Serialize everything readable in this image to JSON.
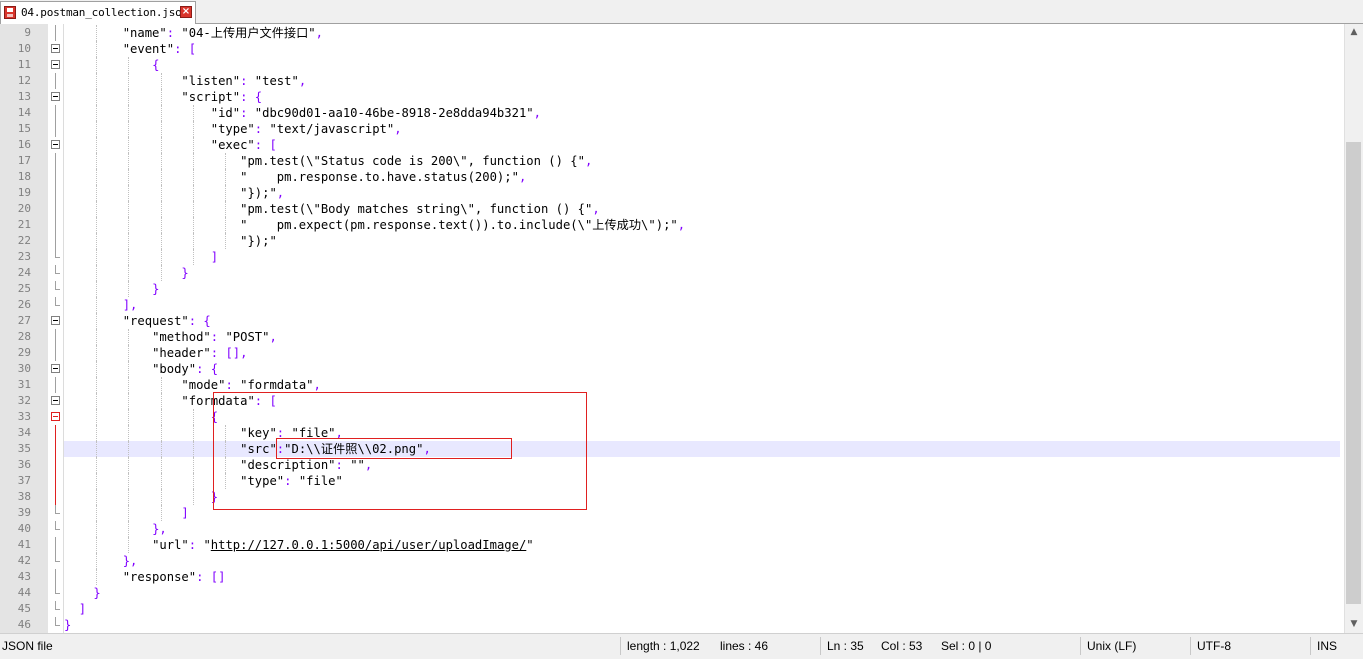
{
  "tab": {
    "filename": "04.postman_collection.json",
    "save_icon": "save-icon",
    "close_icon": "close-icon"
  },
  "editor": {
    "lines": [
      {
        "n": "9",
        "segs": [
          [
            "        ",
            ""
          ],
          [
            "\"name\"",
            "key"
          ],
          [
            ": ",
            "punc"
          ],
          [
            "\"04-上传用户文件接口\"",
            "str"
          ],
          [
            ",",
            "punc"
          ]
        ]
      },
      {
        "n": "10",
        "segs": [
          [
            "        ",
            ""
          ],
          [
            "\"event\"",
            "key"
          ],
          [
            ": [",
            "punc"
          ]
        ]
      },
      {
        "n": "11",
        "segs": [
          [
            "            ",
            ""
          ],
          [
            "{",
            "punc"
          ]
        ]
      },
      {
        "n": "12",
        "segs": [
          [
            "                ",
            ""
          ],
          [
            "\"listen\"",
            "key"
          ],
          [
            ": ",
            "punc"
          ],
          [
            "\"test\"",
            "str"
          ],
          [
            ",",
            "punc"
          ]
        ]
      },
      {
        "n": "13",
        "segs": [
          [
            "                ",
            ""
          ],
          [
            "\"script\"",
            "key"
          ],
          [
            ": {",
            "punc"
          ]
        ]
      },
      {
        "n": "14",
        "segs": [
          [
            "                    ",
            ""
          ],
          [
            "\"id\"",
            "key"
          ],
          [
            ": ",
            "punc"
          ],
          [
            "\"dbc90d01-aa10-46be-8918-2e8dda94b321\"",
            "str"
          ],
          [
            ",",
            "punc"
          ]
        ]
      },
      {
        "n": "15",
        "segs": [
          [
            "                    ",
            ""
          ],
          [
            "\"type\"",
            "key"
          ],
          [
            ": ",
            "punc"
          ],
          [
            "\"text/javascript\"",
            "str"
          ],
          [
            ",",
            "punc"
          ]
        ]
      },
      {
        "n": "16",
        "segs": [
          [
            "                    ",
            ""
          ],
          [
            "\"exec\"",
            "key"
          ],
          [
            ": [",
            "punc"
          ]
        ]
      },
      {
        "n": "17",
        "segs": [
          [
            "                        ",
            ""
          ],
          [
            "\"pm.test(\\\"Status code is 200\\\", function () {\"",
            "str"
          ],
          [
            ",",
            "punc"
          ]
        ]
      },
      {
        "n": "18",
        "segs": [
          [
            "                        ",
            ""
          ],
          [
            "\"    pm.response.to.have.status(200);\"",
            "str"
          ],
          [
            ",",
            "punc"
          ]
        ]
      },
      {
        "n": "19",
        "segs": [
          [
            "                        ",
            ""
          ],
          [
            "\"});\"",
            "str"
          ],
          [
            ",",
            "punc"
          ]
        ]
      },
      {
        "n": "20",
        "segs": [
          [
            "                        ",
            ""
          ],
          [
            "\"pm.test(\\\"Body matches string\\\", function () {\"",
            "str"
          ],
          [
            ",",
            "punc"
          ]
        ]
      },
      {
        "n": "21",
        "segs": [
          [
            "                        ",
            ""
          ],
          [
            "\"    pm.expect(pm.response.text()).to.include(\\\"上传成功\\\");\"",
            "str"
          ],
          [
            ",",
            "punc"
          ]
        ]
      },
      {
        "n": "22",
        "segs": [
          [
            "                        ",
            ""
          ],
          [
            "\"});\"",
            "str"
          ]
        ]
      },
      {
        "n": "23",
        "segs": [
          [
            "                    ",
            ""
          ],
          [
            "]",
            "punc"
          ]
        ]
      },
      {
        "n": "24",
        "segs": [
          [
            "                ",
            ""
          ],
          [
            "}",
            "punc"
          ]
        ]
      },
      {
        "n": "25",
        "segs": [
          [
            "            ",
            ""
          ],
          [
            "}",
            "punc"
          ]
        ]
      },
      {
        "n": "26",
        "segs": [
          [
            "        ",
            ""
          ],
          [
            "],",
            "punc"
          ]
        ]
      },
      {
        "n": "27",
        "segs": [
          [
            "        ",
            ""
          ],
          [
            "\"request\"",
            "key"
          ],
          [
            ": {",
            "punc"
          ]
        ]
      },
      {
        "n": "28",
        "segs": [
          [
            "            ",
            ""
          ],
          [
            "\"method\"",
            "key"
          ],
          [
            ": ",
            "punc"
          ],
          [
            "\"POST\"",
            "str"
          ],
          [
            ",",
            "punc"
          ]
        ]
      },
      {
        "n": "29",
        "segs": [
          [
            "            ",
            ""
          ],
          [
            "\"header\"",
            "key"
          ],
          [
            ": [],",
            "punc"
          ]
        ]
      },
      {
        "n": "30",
        "segs": [
          [
            "            ",
            ""
          ],
          [
            "\"body\"",
            "key"
          ],
          [
            ": {",
            "punc"
          ]
        ]
      },
      {
        "n": "31",
        "segs": [
          [
            "                ",
            ""
          ],
          [
            "\"mode\"",
            "key"
          ],
          [
            ": ",
            "punc"
          ],
          [
            "\"formdata\"",
            "str"
          ],
          [
            ",",
            "punc"
          ]
        ]
      },
      {
        "n": "32",
        "segs": [
          [
            "                ",
            ""
          ],
          [
            "\"formdata\"",
            "key"
          ],
          [
            ": [",
            "punc"
          ]
        ]
      },
      {
        "n": "33",
        "segs": [
          [
            "                    ",
            ""
          ],
          [
            "{",
            "punc"
          ]
        ]
      },
      {
        "n": "34",
        "segs": [
          [
            "                        ",
            ""
          ],
          [
            "\"key\"",
            "key"
          ],
          [
            ": ",
            "punc"
          ],
          [
            "\"file\"",
            "str"
          ],
          [
            ",",
            "punc"
          ]
        ]
      },
      {
        "n": "35",
        "segs": [
          [
            "                        ",
            ""
          ],
          [
            "\"src\"",
            "key"
          ],
          [
            ":",
            "punc"
          ],
          [
            "\"D:\\\\证件照\\\\02.png\"",
            "str"
          ],
          [
            ",",
            "punc"
          ]
        ]
      },
      {
        "n": "36",
        "segs": [
          [
            "                        ",
            ""
          ],
          [
            "\"description\"",
            "key"
          ],
          [
            ": ",
            "punc"
          ],
          [
            "\"\"",
            "str"
          ],
          [
            ",",
            "punc"
          ]
        ]
      },
      {
        "n": "37",
        "segs": [
          [
            "                        ",
            ""
          ],
          [
            "\"type\"",
            "key"
          ],
          [
            ": ",
            "punc"
          ],
          [
            "\"file\"",
            "str"
          ]
        ]
      },
      {
        "n": "38",
        "segs": [
          [
            "                    ",
            ""
          ],
          [
            "}",
            "punc"
          ]
        ]
      },
      {
        "n": "39",
        "segs": [
          [
            "                ",
            ""
          ],
          [
            "]",
            "punc"
          ]
        ]
      },
      {
        "n": "40",
        "segs": [
          [
            "            ",
            ""
          ],
          [
            "},",
            "punc"
          ]
        ]
      },
      {
        "n": "41",
        "segs": [
          [
            "            ",
            ""
          ],
          [
            "\"url\"",
            "key"
          ],
          [
            ": ",
            "punc"
          ],
          [
            "\"",
            "str"
          ],
          [
            "http://127.0.0.1:5000/api/user/uploadImage/",
            "url"
          ],
          [
            "\"",
            "str"
          ]
        ]
      },
      {
        "n": "42",
        "segs": [
          [
            "        ",
            ""
          ],
          [
            "},",
            "punc"
          ]
        ]
      },
      {
        "n": "43",
        "segs": [
          [
            "        ",
            ""
          ],
          [
            "\"response\"",
            "key"
          ],
          [
            ": []",
            "punc"
          ]
        ]
      },
      {
        "n": "44",
        "segs": [
          [
            "    ",
            ""
          ],
          [
            "}",
            "punc"
          ]
        ]
      },
      {
        "n": "45",
        "segs": [
          [
            "  ",
            ""
          ],
          [
            "]",
            "punc"
          ]
        ]
      },
      {
        "n": "46",
        "segs": [
          [
            "",
            ""
          ],
          [
            "}",
            "punc"
          ]
        ]
      }
    ],
    "current_line": "35"
  },
  "statusbar": {
    "file_type": "JSON file",
    "length": "length : 1,022",
    "lines": "lines : 46",
    "ln": "Ln : 35",
    "col": "Col : 53",
    "sel": "Sel : 0 | 0",
    "eol": "Unix (LF)",
    "encoding": "UTF-8",
    "mode": "INS"
  },
  "colors": {
    "annotation": "#e02020",
    "punctuation": "#8000ff",
    "current_line": "#e8e8ff",
    "gutter": "#e4e4e4"
  }
}
